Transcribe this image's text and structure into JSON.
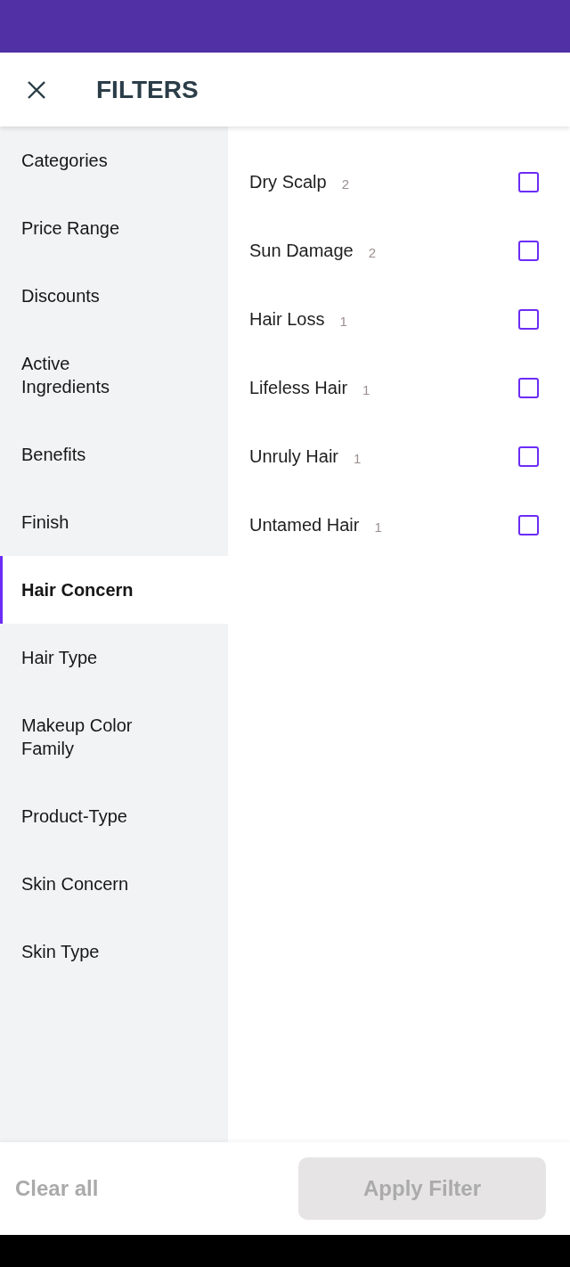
{
  "header": {
    "title": "FILTERS"
  },
  "categories": [
    {
      "label": "Categories",
      "selected": false
    },
    {
      "label": "Price Range",
      "selected": false
    },
    {
      "label": "Discounts",
      "selected": false
    },
    {
      "label": "Active Ingredients",
      "selected": false
    },
    {
      "label": "Benefits",
      "selected": false
    },
    {
      "label": "Finish",
      "selected": false
    },
    {
      "label": "Hair Concern",
      "selected": true
    },
    {
      "label": "Hair Type",
      "selected": false
    },
    {
      "label": "Makeup Color Family",
      "selected": false
    },
    {
      "label": "Product-Type",
      "selected": false
    },
    {
      "label": "Skin Concern",
      "selected": false
    },
    {
      "label": "Skin Type",
      "selected": false
    }
  ],
  "options": [
    {
      "label": "Dry Scalp",
      "count": "2",
      "checked": false
    },
    {
      "label": "Sun Damage",
      "count": "2",
      "checked": false
    },
    {
      "label": "Hair Loss",
      "count": "1",
      "checked": false
    },
    {
      "label": "Lifeless Hair",
      "count": "1",
      "checked": false
    },
    {
      "label": "Unruly Hair",
      "count": "1",
      "checked": false
    },
    {
      "label": "Untamed Hair",
      "count": "1",
      "checked": false
    }
  ],
  "footer": {
    "clear": {
      "label": "Clear all",
      "disabled": true
    },
    "apply": {
      "label": "Apply Filter",
      "disabled": true
    }
  }
}
